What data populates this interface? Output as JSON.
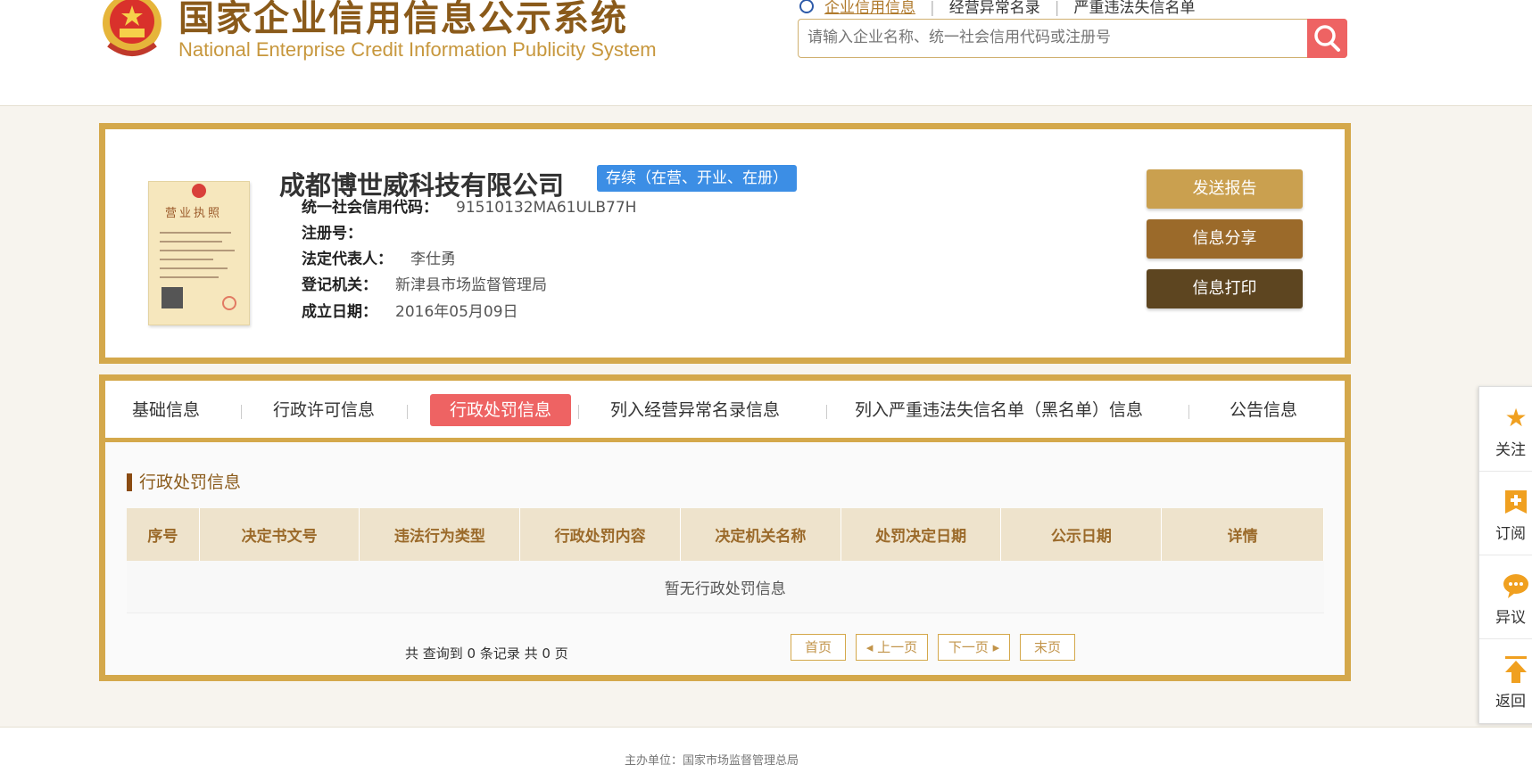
{
  "site": {
    "title_cn": "国家企业信用信息公示系统",
    "title_en": "National Enterprise Credit Information Publicity System"
  },
  "nav": {
    "items": [
      "企业信用信息",
      "经营异常名录",
      "严重违法失信名单"
    ]
  },
  "search": {
    "placeholder": "请输入企业名称、统一社会信用代码或注册号",
    "icon": "search-icon"
  },
  "company": {
    "name": "成都博世威科技有限公司",
    "status": "存续（在营、开业、在册）",
    "fields": [
      {
        "label": "统一社会信用代码：",
        "value": "91510132MA61ULB77H"
      },
      {
        "label": "注册号：",
        "value": ""
      },
      {
        "label": "法定代表人：",
        "value": "李仕勇"
      },
      {
        "label": "登记机关：",
        "value": "新津县市场监督管理局"
      },
      {
        "label": "成立日期：",
        "value": "2016年05月09日"
      }
    ],
    "license_title": "营业执照"
  },
  "actions": {
    "send_report": "发送报告",
    "share": "信息分享",
    "print": "信息打印"
  },
  "tabs": [
    {
      "label": "基础信息"
    },
    {
      "label": "行政许可信息"
    },
    {
      "label": "行政处罚信息",
      "active": true
    },
    {
      "label": "列入经营异常名录信息"
    },
    {
      "label": "列入严重违法失信名单（黑名单）信息"
    },
    {
      "label": "公告信息"
    }
  ],
  "section": {
    "title": "行政处罚信息",
    "columns": [
      "序号",
      "决定书文号",
      "违法行为类型",
      "行政处罚内容",
      "决定机关名称",
      "处罚决定日期",
      "公示日期",
      "详情"
    ],
    "empty_text": "暂无行政处罚信息",
    "records_text": "共 查询到 0 条记录 共 0 页"
  },
  "pager": {
    "first": "首页",
    "prev": "上一页",
    "next": "下一页",
    "last": "末页"
  },
  "side_toolbar": [
    {
      "label": "关注",
      "icon": "star-icon"
    },
    {
      "label": "订阅",
      "icon": "subscribe-icon"
    },
    {
      "label": "异议",
      "icon": "comment-icon"
    },
    {
      "label": "返回",
      "icon": "back-to-top-icon"
    }
  ],
  "footer": {
    "text": "主办单位：国家市场监督管理总局"
  },
  "colors": {
    "gold_border": "#d4a84b",
    "accent_red": "#ee6363",
    "status_blue": "#3c8ee5",
    "brown_title": "#8a5a1a"
  }
}
